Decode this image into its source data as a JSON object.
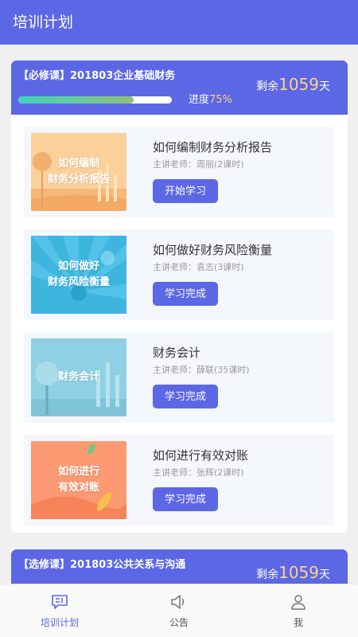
{
  "header": {
    "title": "培训计划"
  },
  "required_course": {
    "tag_title": "【必修课】201803企业基础财务",
    "remain_prefix": "剩余",
    "remain_days": "1059",
    "remain_suffix": "天",
    "progress_prefix": "进度",
    "progress_value": "75%",
    "progress_fraction": 0.75,
    "lessons": [
      {
        "thumb_text": "如何编制\n财务分析报告",
        "title": "如何编制财务分析报告",
        "teacher": "主讲老师：周丽(2课时)",
        "button": "开始学习"
      },
      {
        "thumb_text": "如何做好\n财务风险衡量",
        "title": "如何做好财务风险衡量",
        "teacher": "主讲老师：袁志(3课时)",
        "button": "学习完成"
      },
      {
        "thumb_text": "财务会计",
        "title": "财务会计",
        "teacher": "主讲老师：薛联(35课时)",
        "button": "学习完成"
      },
      {
        "thumb_text": "如何进行\n有效对账",
        "title": "如何进行有效对账",
        "teacher": "主讲老师：张辉(2课时)",
        "button": "学习完成"
      }
    ]
  },
  "elective_course": {
    "tag_title": "【选修课】201803公共关系与沟通",
    "remain_prefix": "剩余",
    "remain_days": "1059",
    "remain_suffix": "天"
  },
  "tabbar": [
    {
      "label": "培训计划",
      "icon": "chat-training-icon",
      "active": true
    },
    {
      "label": "公告",
      "icon": "speaker-icon",
      "active": false
    },
    {
      "label": "我",
      "icon": "person-icon",
      "active": false
    }
  ],
  "colors": {
    "primary": "#5b67e5",
    "highlight": "#ffd28a",
    "background": "#f0f0f0"
  }
}
